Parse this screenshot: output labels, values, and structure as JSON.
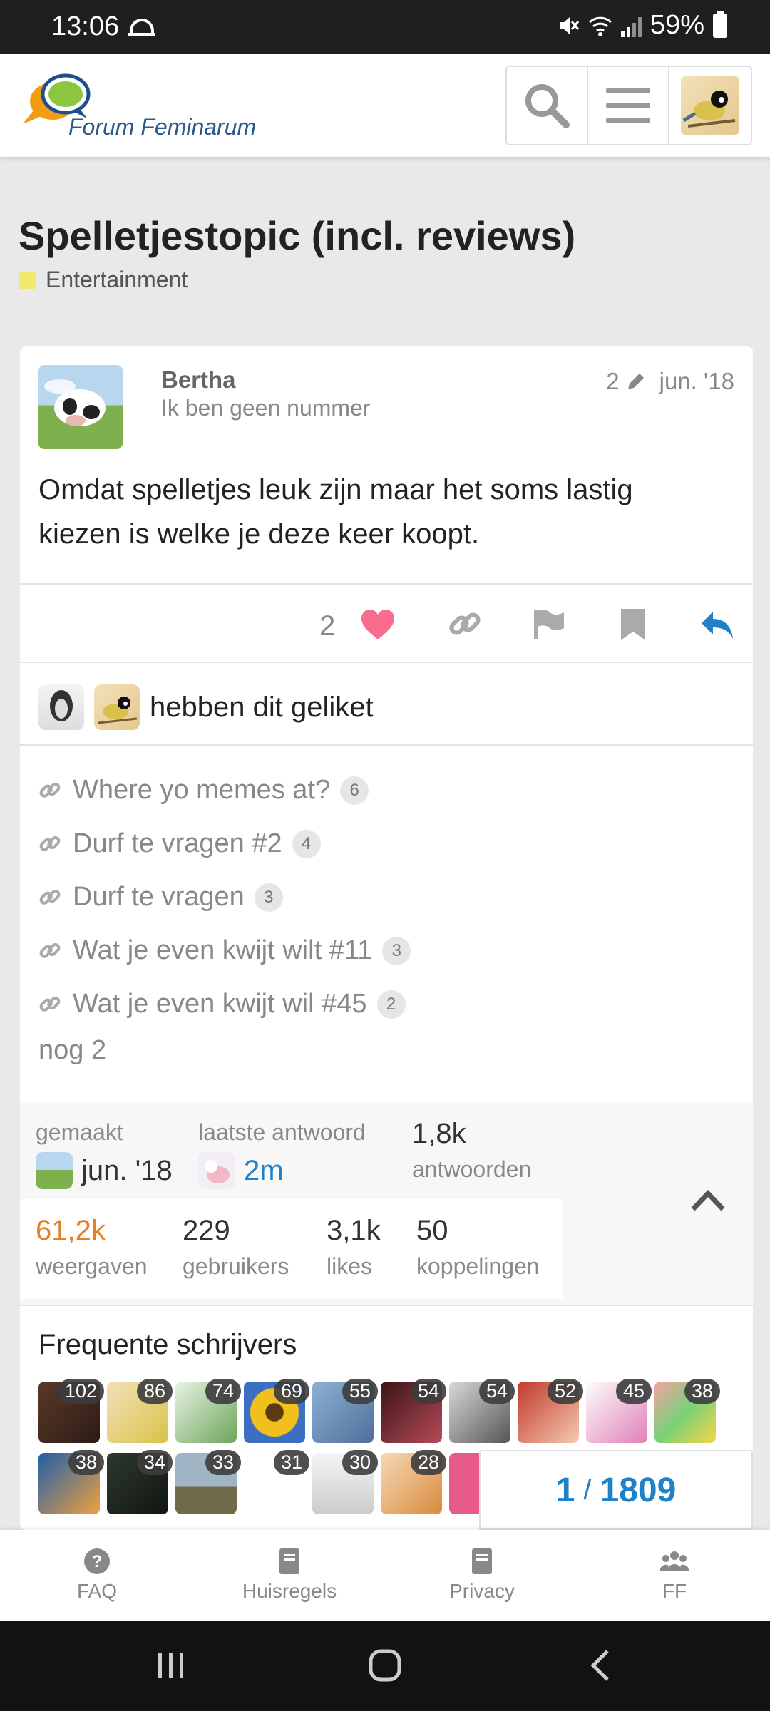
{
  "status_bar": {
    "time": "13:06",
    "battery": "59%"
  },
  "header": {
    "logo_text": "Forum Feminarum"
  },
  "topic": {
    "title": "Spelletjestopic (incl. reviews)",
    "category": "Entertainment",
    "category_color": "#f1e96b"
  },
  "post": {
    "username": "Bertha",
    "user_title": "Ik ben geen nummer",
    "edits": "2",
    "date": "jun. '18",
    "body": "Omdat spelletjes leuk zijn maar het soms lastig kiezen is welke je deze keer koopt.",
    "likes": "2",
    "liked_text": "hebben dit geliket"
  },
  "links": [
    {
      "title": "Where yo memes at?",
      "clicks": "6"
    },
    {
      "title": "Durf te vragen #2",
      "clicks": "4"
    },
    {
      "title": "Durf te vragen",
      "clicks": "3"
    },
    {
      "title": "Wat je even kwijt wilt #11",
      "clicks": "3"
    },
    {
      "title": "Wat je even kwijt wil #45",
      "clicks": "2"
    }
  ],
  "links_more": "nog 2",
  "topic_map": {
    "created_label": "gemaakt",
    "created_value": "jun. '18",
    "last_reply_label": "laatste antwoord",
    "last_reply_value": "2m",
    "replies_value": "1,8k",
    "replies_label": "antwoorden",
    "views_value": "61,2k",
    "views_label": "weergaven",
    "users_value": "229",
    "users_label": "gebruikers",
    "likes_value": "3,1k",
    "likes_label": "likes",
    "links_value": "50",
    "links_label": "koppelingen"
  },
  "frequent_posters": {
    "title": "Frequente schrijvers",
    "counts_row1": [
      "102",
      "86",
      "74",
      "69",
      "55",
      "54",
      "54",
      "52",
      "45",
      "38"
    ],
    "counts_row2": [
      "38",
      "34",
      "33",
      "31",
      "30",
      "28"
    ]
  },
  "progress": {
    "current": "1",
    "sep": "/",
    "total": "1809"
  },
  "footer": {
    "faq": "FAQ",
    "rules": "Huisregels",
    "privacy": "Privacy",
    "ff": "FF"
  },
  "colors": {
    "accent": "#1f81c7",
    "like": "#fa6c8d",
    "views": "#e67e22"
  }
}
